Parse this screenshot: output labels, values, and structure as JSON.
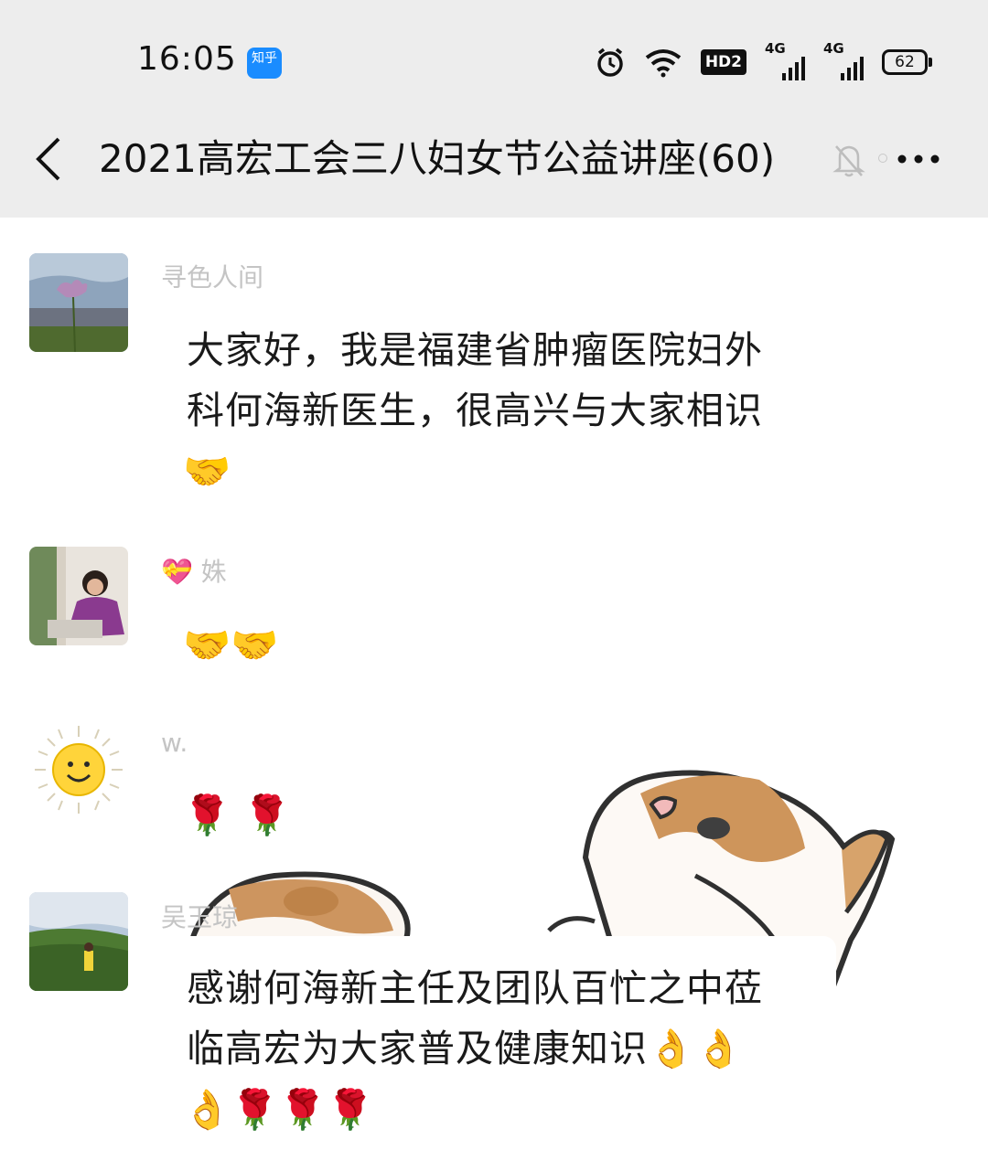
{
  "status_bar": {
    "time": "16:05",
    "app_badge": "知乎",
    "hd_label": "HD2",
    "network1": "4G",
    "network2": "4G",
    "battery": "62"
  },
  "header": {
    "back_icon": "chevron-left-icon",
    "title": "2021高宏工会三八妇女节公益讲座(60)",
    "mute_icon": "bell-off-icon",
    "more_icon": "more-dots-icon"
  },
  "messages": [
    {
      "sender": "寻色人间",
      "lines": [
        "大家好，我是福建省肿瘤医院妇外",
        "科何海新医生，很高兴与大家相识"
      ],
      "emoji": "🤝"
    },
    {
      "sender": "💝 姝",
      "emoji": "🤝🤝"
    },
    {
      "sender": "w.",
      "emoji": "🌹 🌹"
    },
    {
      "sender": "吴玉琼",
      "lines": [
        "感谢何海新主任及团队百忙之中莅",
        "临高宏为大家普及健康知识👌👌"
      ],
      "emoji": "👌🌹🌹🌹"
    }
  ],
  "colors": {
    "header_bg": "#ededed",
    "chat_bg": "#ffffff",
    "name_color": "#c4c4c4"
  }
}
